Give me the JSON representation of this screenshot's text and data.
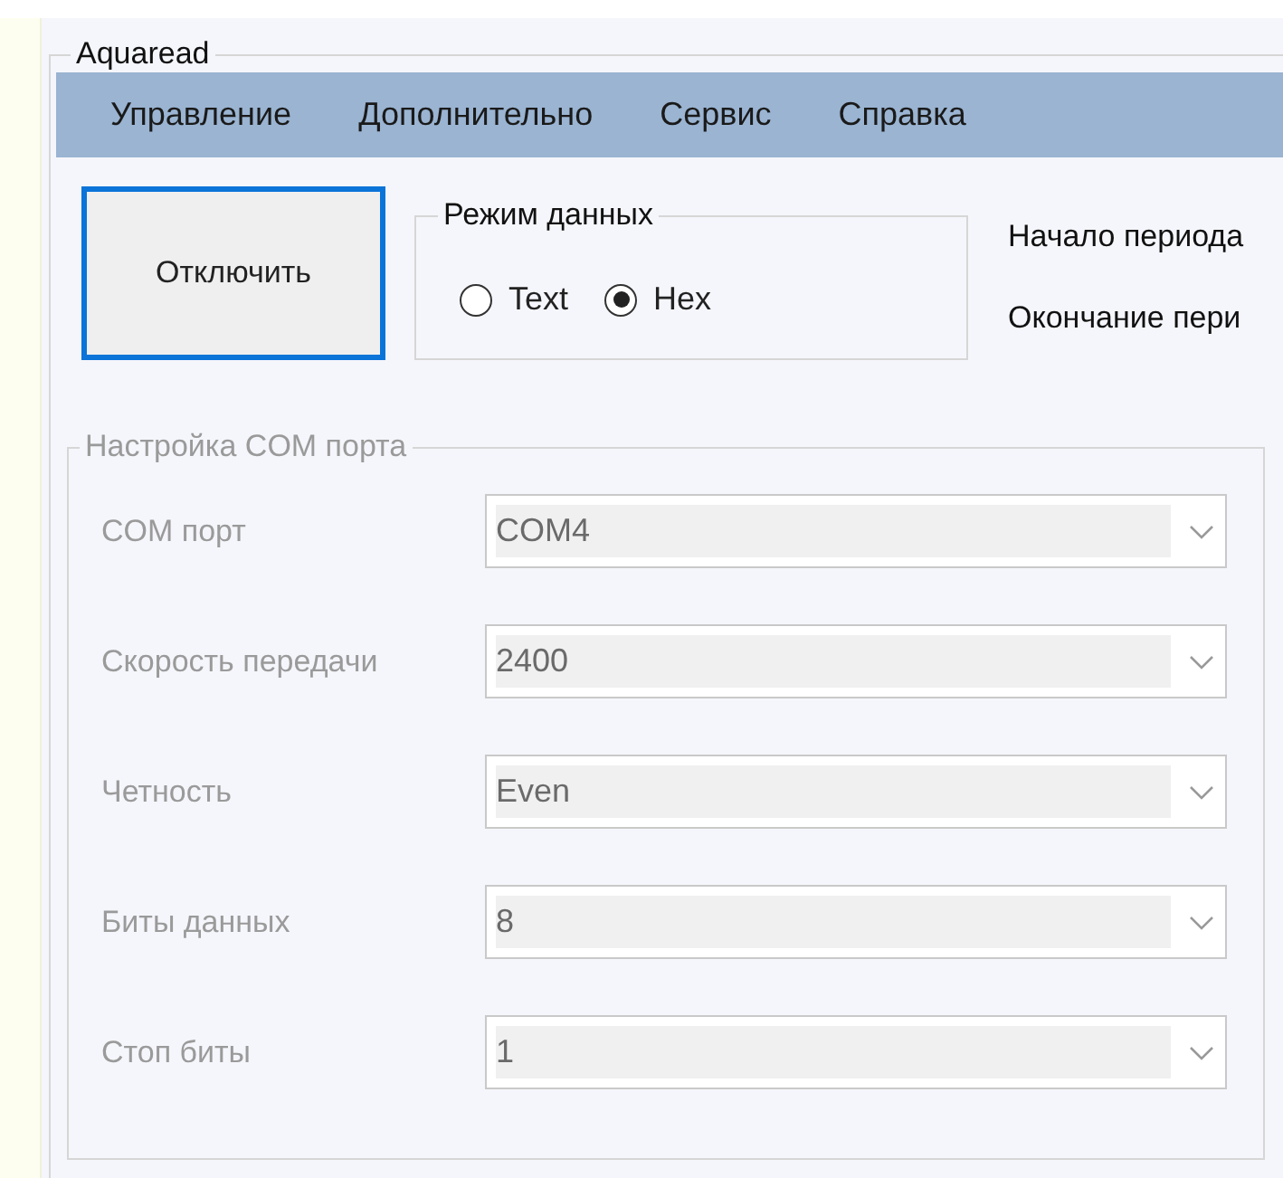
{
  "window": {
    "title": "Aquaread"
  },
  "menu": [
    {
      "label": "Управление"
    },
    {
      "label": "Дополнительно"
    },
    {
      "label": "Сервис"
    },
    {
      "label": "Справка"
    }
  ],
  "connect_button": {
    "label": "Отключить",
    "focused": true
  },
  "data_mode": {
    "title": "Режим данных",
    "options": [
      {
        "label": "Text",
        "selected": false
      },
      {
        "label": "Hex",
        "selected": true
      }
    ]
  },
  "period_labels": [
    "Начало периода",
    "Окончание пери"
  ],
  "com_settings": {
    "title": "Настройка COM порта",
    "disabled": true,
    "fields": [
      {
        "label": "COM порт",
        "value": "COM4"
      },
      {
        "label": "Скорость передачи",
        "value": "2400"
      },
      {
        "label": "Четность",
        "value": "Even"
      },
      {
        "label": "Биты данных",
        "value": "8"
      },
      {
        "label": "Стоп биты",
        "value": "1"
      }
    ]
  }
}
